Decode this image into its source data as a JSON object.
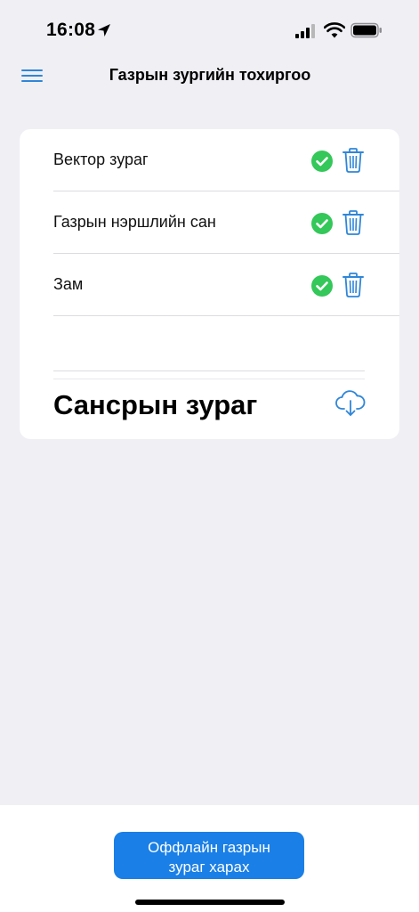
{
  "status_bar": {
    "time": "16:08"
  },
  "header": {
    "title": "Газрын зургийн тохиргоо"
  },
  "layers": {
    "items": [
      {
        "label": "Вектор зураг"
      },
      {
        "label": "Газрын нэршлийн сан"
      },
      {
        "label": "Зам"
      }
    ]
  },
  "satellite": {
    "label": "Сансрын зураг"
  },
  "bottom": {
    "offline_button_line1": "Оффлайн газрын",
    "offline_button_line2": "зураг харах"
  },
  "colors": {
    "background": "#efeff4",
    "accent": "#1a7fe6",
    "success": "#34c759",
    "icon_blue": "#2f86d8"
  },
  "icons": {
    "menu": "hamburger-menu-icon",
    "check": "check-circle-icon",
    "delete": "trash-icon",
    "download": "cloud-download-icon"
  }
}
